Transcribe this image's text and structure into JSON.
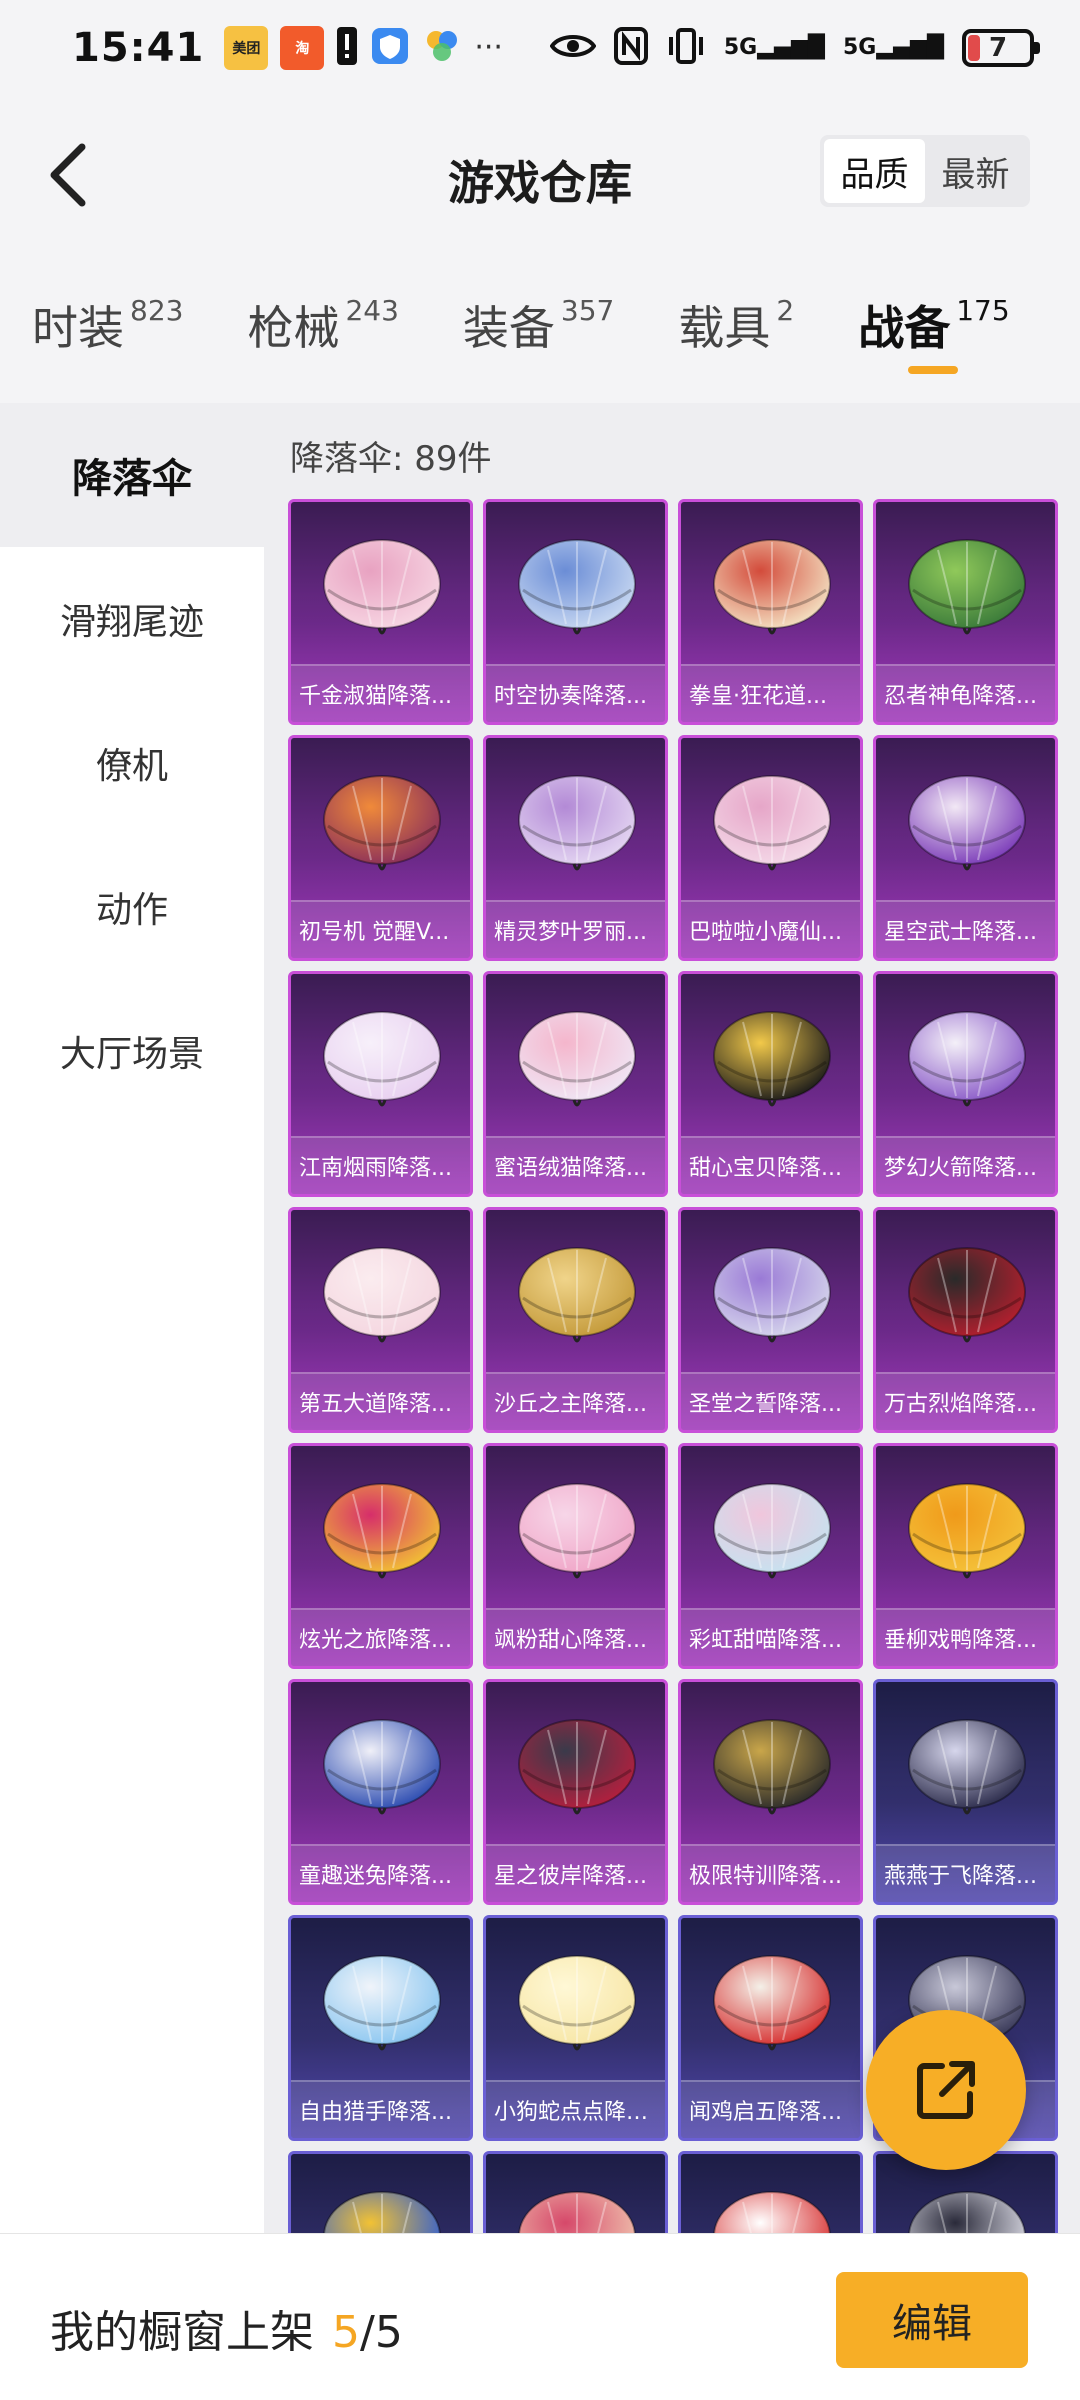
{
  "status_bar": {
    "time": "15:41",
    "apps": [
      "美团",
      "淘"
    ],
    "more": "···",
    "sig1": "5G",
    "sig2": "5G",
    "battery": "7"
  },
  "header": {
    "title": "游戏仓库",
    "sort_options": [
      "品质",
      "最新"
    ],
    "active_sort": "品质"
  },
  "categories": [
    {
      "label": "时装",
      "count": "823"
    },
    {
      "label": "枪械",
      "count": "243"
    },
    {
      "label": "装备",
      "count": "357"
    },
    {
      "label": "载具",
      "count": "2"
    },
    {
      "label": "战备",
      "count": "175"
    }
  ],
  "sidebar": {
    "items": [
      "降落伞",
      "滑翔尾迹",
      "僚机",
      "动作",
      "大厅场景"
    ]
  },
  "content": {
    "count_label": "降落伞: 89件"
  },
  "items": [
    "千金淑猫降落...",
    "时空协奏降落...",
    "拳皇·狂花道...",
    "忍者神龟降落...",
    "初号机 觉醒V...",
    "精灵梦叶罗丽...",
    "巴啦啦小魔仙...",
    "星空武士降落...",
    "江南烟雨降落...",
    "蜜语绒猫降落...",
    "甜心宝贝降落...",
    "梦幻火箭降落...",
    "第五大道降落...",
    "沙丘之主降落...",
    "圣堂之誓降落...",
    "万古烈焰降落...",
    "炫光之旅降落...",
    "飒粉甜心降落...",
    "彩虹甜喵降落...",
    "垂柳戏鸭降落...",
    "童趣迷兔降落...",
    "星之彼岸降落...",
    "极限特训降落...",
    "燕燕于飞降落...",
    "自由猎手降落...",
    "小狗蛇点点降落...",
    "闻鸡启五降落...",
    "...",
    "",
    "",
    "",
    ""
  ],
  "item_colors": {
    "purple": "#8a2fb0",
    "blue": "#3d3890",
    "accent": "#f5a623"
  },
  "bottom": {
    "shelf_label": "我的橱窗上架",
    "shelf_count": "5",
    "shelf_total": "/5",
    "edit": "编辑"
  }
}
